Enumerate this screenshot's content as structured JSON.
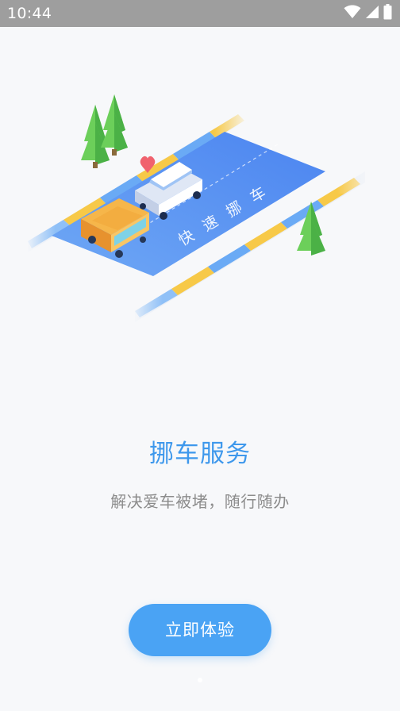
{
  "status_bar": {
    "time": "10:44",
    "icons": [
      "wifi-icon",
      "cell-signal-icon",
      "battery-icon"
    ]
  },
  "hero": {
    "road_text": "快速挪车",
    "colors": {
      "road": "#5b93f2",
      "stripe_yellow": "#f7c948",
      "stripe_blue": "#6aaaf5",
      "tree": "#5cc24a"
    }
  },
  "title": "挪车服务",
  "subtitle": "解决爱车被堵，随行随办",
  "cta_label": "立即体验",
  "pager": {
    "pages": 3,
    "current": 1
  },
  "colors": {
    "title": "#3e98ec",
    "button": "#4aa3f4",
    "status_bar": "#9e9e9e"
  }
}
